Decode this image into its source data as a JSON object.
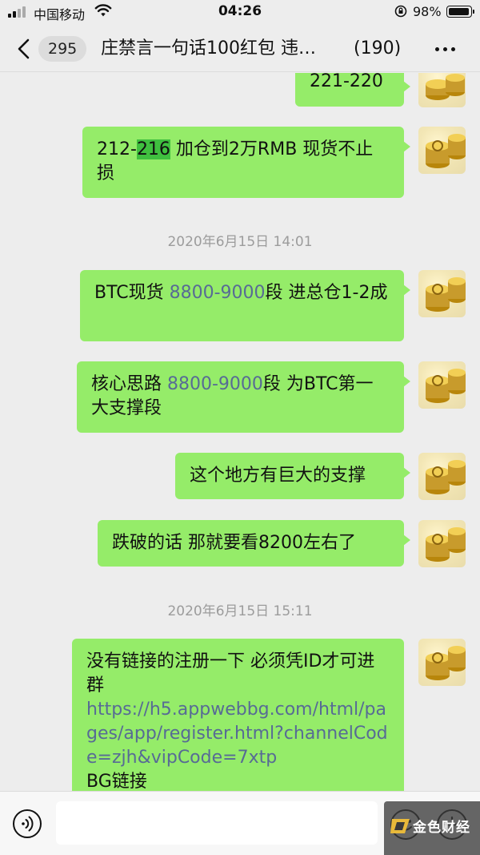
{
  "status_bar": {
    "carrier": "中国移动",
    "time": "04:26",
    "battery": "98%"
  },
  "nav": {
    "unread_count": "295",
    "title": "庄禁言一句话100红包 违…",
    "member_count": "(190)"
  },
  "messages": [
    {
      "type": "text",
      "parts": [
        {
          "text": "221-220"
        }
      ]
    },
    {
      "type": "text",
      "parts": [
        {
          "text": "212-"
        },
        {
          "text": "216",
          "style": "highlight"
        },
        {
          "text": " 加仓到2万RMB   现货不止损"
        }
      ]
    },
    {
      "type": "time",
      "text": "2020年6月15日 14:01"
    },
    {
      "type": "text",
      "parts": [
        {
          "text": "BTC现货 "
        },
        {
          "text": "8800-9000",
          "style": "link"
        },
        {
          "text": "段 进总仓1-2成"
        }
      ]
    },
    {
      "type": "text",
      "parts": [
        {
          "text": "核心思路 "
        },
        {
          "text": "8800-9000",
          "style": "link"
        },
        {
          "text": "段 为BTC第一大支撑段"
        }
      ]
    },
    {
      "type": "text",
      "parts": [
        {
          "text": "这个地方有巨大的支撑"
        }
      ]
    },
    {
      "type": "text",
      "parts": [
        {
          "text": "跌破的话 那就要看8200左右了"
        }
      ]
    },
    {
      "type": "time",
      "text": "2020年6月15日 15:11"
    },
    {
      "type": "text",
      "parts": [
        {
          "text": "没有链接的注册一下 必须凭ID才可进群"
        },
        {
          "text": "https://h5.appwebbg.com/html/pages/app/register.html?channelCode=zjh&vipCode=7xtp",
          "style": "link"
        },
        {
          "text": "BG链接"
        }
      ]
    }
  ],
  "input_bar": {
    "placeholder": "",
    "icons": [
      "voice-icon",
      "emoji-icon",
      "plus-icon"
    ]
  },
  "watermark": {
    "text": "金色财经"
  },
  "colors": {
    "background": "#ededed",
    "bubble_self": "#95ec69",
    "link": "#576b95",
    "timestamp": "#9c9c9c"
  }
}
